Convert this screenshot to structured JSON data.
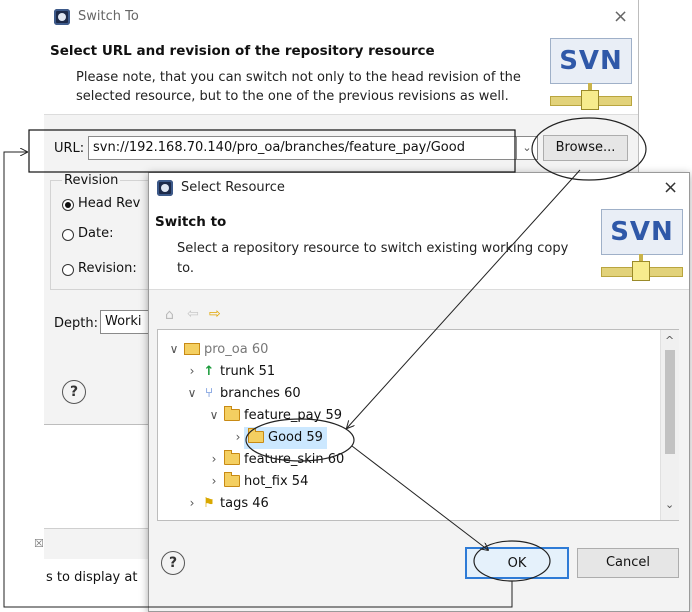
{
  "switch_dialog": {
    "title": "Switch To",
    "close_label": "×",
    "header_title": "Select URL and revision of the repository resource",
    "header_desc_line1": "Please note, that you can switch not only to the head revision of the",
    "header_desc_line2": "selected resource, but to the one of the previous revisions as well.",
    "svn_logo_text": "SVN",
    "url_label": "URL:",
    "url_value": "svn://192.168.70.140/pro_oa/branches/feature_pay/Good",
    "url_dropdown_glyph": "⌄",
    "browse_label": "Browse...",
    "revision_group_label": "Revision",
    "radio_head_label": "Head Rev",
    "radio_date_label": "Date:",
    "radio_revision_label": "Revision:",
    "depth_label": "Depth:",
    "depth_value": "Worki",
    "help_glyph": "?"
  },
  "background_view": {
    "tab_close_glyph": "☒",
    "status_text": "s to display at"
  },
  "select_dialog": {
    "title": "Select Resource",
    "close_label": "×",
    "header_title": "Switch to",
    "header_desc_line1": "Select a repository resource to switch existing working copy",
    "header_desc_line2": "to.",
    "svn_logo_text": "SVN",
    "toolbar": {
      "home_icon": "home-icon",
      "back_icon": "back-arrow-icon",
      "forward_icon": "forward-arrow-icon"
    },
    "tree": [
      {
        "label": "pro_oa 60",
        "twisty": "∨",
        "icon": "repository-icon",
        "selected": false
      },
      {
        "label": "trunk 51",
        "twisty": "›",
        "icon": "trunk-icon",
        "selected": false
      },
      {
        "label": "branches 60",
        "twisty": "∨",
        "icon": "branches-icon",
        "selected": false
      },
      {
        "label": "feature_pay 59",
        "twisty": "∨",
        "icon": "folder-open-icon",
        "selected": false
      },
      {
        "label": "Good 59",
        "twisty": "›",
        "icon": "folder-open-icon",
        "selected": true
      },
      {
        "label": "feature_skin 60",
        "twisty": "›",
        "icon": "folder-icon",
        "selected": false
      },
      {
        "label": "hot_fix 54",
        "twisty": "›",
        "icon": "folder-icon",
        "selected": false
      },
      {
        "label": "tags 46",
        "twisty": "›",
        "icon": "tags-icon",
        "selected": false
      }
    ],
    "help_glyph": "?",
    "ok_label": "OK",
    "cancel_label": "Cancel",
    "scroll_up_glyph": "^",
    "scroll_down_glyph": "⌄"
  },
  "colors": {
    "dialog_bg": "#f3f3f3",
    "selection_bg": "#cce8ff",
    "ok_border": "#2e7bd6",
    "annotation_line": "#222222"
  }
}
